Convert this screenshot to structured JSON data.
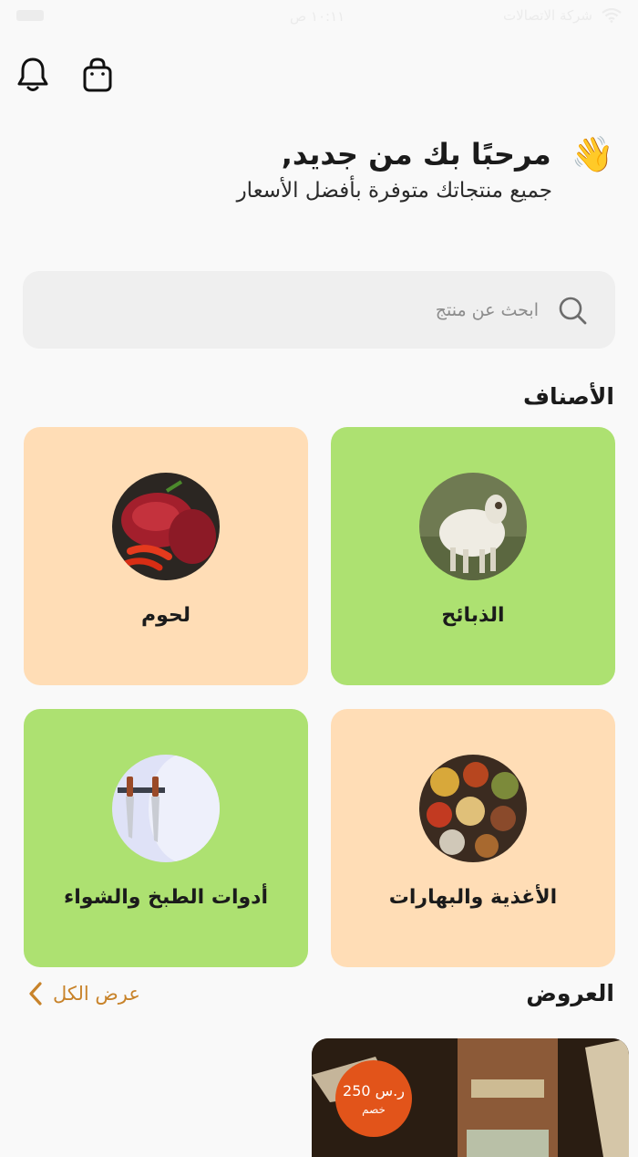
{
  "status_bar": {
    "carrier": "شركة الاتصالات",
    "time": "١٠:١١ ص"
  },
  "greeting": {
    "wave_emoji": "👋",
    "title": "مرحبًا بك من جديد,",
    "subtitle": "جميع منتجاتك متوفرة بأفضل الأسعار"
  },
  "search": {
    "placeholder": "ابحث عن منتج"
  },
  "categories": {
    "title": "الأصناف",
    "items": [
      {
        "label": "الذبائح",
        "image": "sheep-photo",
        "color": "#ade171"
      },
      {
        "label": "لحوم",
        "image": "meat-photo",
        "color": "#ffddb6"
      },
      {
        "label": "الأغذية والبهارات",
        "image": "spices-photo",
        "color": "#ffddb6"
      },
      {
        "label": "أدوات الطبخ والشواء",
        "image": "knives-plate-photo",
        "color": "#ade171"
      }
    ]
  },
  "offers": {
    "title": "العروض",
    "view_all": "عرض الكل",
    "items": [
      {
        "price": "250 ر.س",
        "discount_label": "خصم",
        "badge_color": "#e2541a"
      }
    ]
  },
  "icons": {
    "notifications": "bell-icon",
    "cart": "shopping-bag-icon",
    "search": "search-icon",
    "view_all": "chevron-left-icon"
  },
  "colors": {
    "accent": "#c8832a",
    "green_card": "#ade171",
    "peach_card": "#ffddb6",
    "background": "#f9f9f9"
  }
}
